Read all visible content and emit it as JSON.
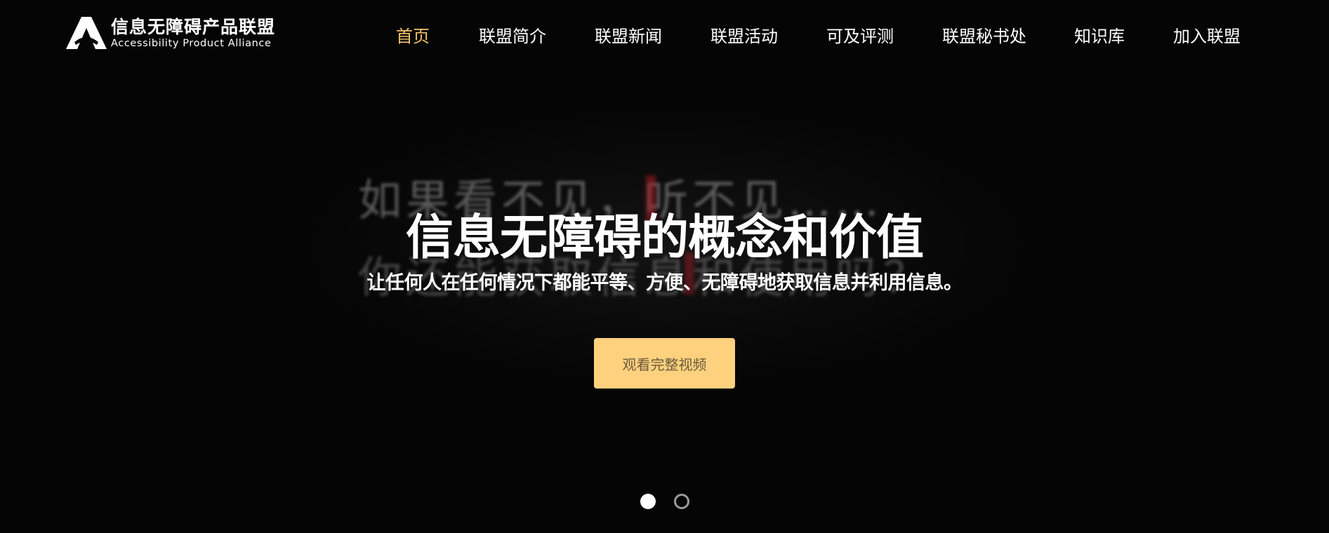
{
  "header": {
    "logo": {
      "name_cn": "信息无障碍产品联盟",
      "name_en": "Accessibility Product Alliance",
      "icon": "alliance-logo-icon"
    },
    "nav": [
      {
        "label": "首页",
        "active": true
      },
      {
        "label": "联盟简介",
        "active": false
      },
      {
        "label": "联盟新闻",
        "active": false
      },
      {
        "label": "联盟活动",
        "active": false
      },
      {
        "label": "可及评测",
        "active": false
      },
      {
        "label": "联盟秘书处",
        "active": false
      },
      {
        "label": "知识库",
        "active": false
      },
      {
        "label": "加入联盟",
        "active": false
      }
    ]
  },
  "hero": {
    "title": "信息无障碍的概念和价值",
    "subtitle": "让任何人在任何情况下都能平等、方便、无障碍地获取信息并利用信息。",
    "cta_label": "观看完整视频",
    "background_line_1": "如果看不见，听不见……",
    "background_line_2": "你还能获取信息和使用吗？"
  },
  "carousel": {
    "slides": 2,
    "active_index": 0
  },
  "colors": {
    "background": "#050505",
    "nav_active": "#f3c26b",
    "nav_default": "#ffffff",
    "cta_bg": "#fed17f",
    "cta_text": "#6b5a3c"
  }
}
